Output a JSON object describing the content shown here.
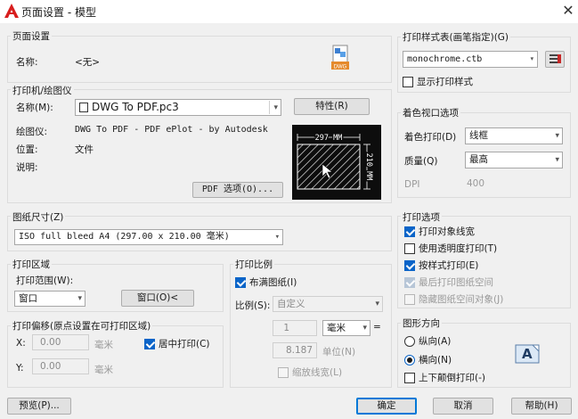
{
  "window": {
    "title": "页面设置 - 模型"
  },
  "page_setup": {
    "legend": "页面设置",
    "name_label": "名称:",
    "name_value": "<无>",
    "file_badge": "DWG"
  },
  "printer": {
    "legend": "打印机/绘图仪",
    "name_label": "名称(M):",
    "name_value": "DWG To PDF.pc3",
    "properties_button": "特性(R)",
    "plotter_label": "绘图仪:",
    "plotter_value": "DWG To PDF - PDF ePlot - by Autodesk",
    "location_label": "位置:",
    "location_value": "文件",
    "description_label": "说明:",
    "pdf_options_button": "PDF 选项(O)...",
    "preview_width_label": "297 MM",
    "preview_height_label": "210 MM"
  },
  "paper_size": {
    "legend": "图纸尺寸(Z)",
    "value": "ISO full bleed A4 (297.00 x 210.00 毫米)"
  },
  "plot_area": {
    "legend": "打印区域",
    "range_label": "打印范围(W):",
    "range_value": "窗口",
    "window_button": "窗口(O)<"
  },
  "plot_offset": {
    "legend": "打印偏移(原点设置在可打印区域)",
    "x_label": "X:",
    "x_value": "0.00",
    "x_unit": "毫米",
    "y_label": "Y:",
    "y_value": "0.00",
    "y_unit": "毫米",
    "center_label": "居中打印(C)",
    "center_checked": true
  },
  "plot_scale": {
    "legend": "打印比例",
    "fit_label": "布满图纸(I)",
    "fit_checked": true,
    "scale_label": "比例(S):",
    "scale_value": "自定义",
    "value1": "1",
    "unit1": "毫米",
    "equals": "=",
    "value2": "8.187",
    "unit2": "单位(N)",
    "lineweights_label": "缩放线宽(L)"
  },
  "plot_style": {
    "legend": "打印样式表(画笔指定)(G)",
    "value": "monochrome.ctb",
    "show_label": "显示打印样式"
  },
  "shaded_viewport": {
    "legend": "着色视口选项",
    "shade_label": "着色打印(D)",
    "shade_value": "线框",
    "quality_label": "质量(Q)",
    "quality_value": "最高",
    "dpi_label": "DPI",
    "dpi_value": "400"
  },
  "plot_options": {
    "legend": "打印选项",
    "items": [
      {
        "label": "打印对象线宽",
        "checked": true,
        "disabled": false
      },
      {
        "label": "使用透明度打印(T)",
        "checked": false,
        "disabled": false
      },
      {
        "label": "按样式打印(E)",
        "checked": true,
        "disabled": false
      },
      {
        "label": "最后打印图纸空间",
        "checked": true,
        "disabled": true
      },
      {
        "label": "隐藏图纸空间对象(J)",
        "checked": false,
        "disabled": true
      }
    ]
  },
  "orientation": {
    "legend": "图形方向",
    "portrait_label": "纵向(A)",
    "landscape_label": "横向(N)",
    "selected": "landscape",
    "upside_down_label": "上下颠倒打印(-)",
    "upside_down_checked": false,
    "preview_letter": "A"
  },
  "footer": {
    "preview_button": "预览(P)...",
    "ok_button": "确定",
    "cancel_button": "取消",
    "help_button": "帮助(H)"
  },
  "colors": {
    "accent": "#0a64c8",
    "app_red": "#d81e1e"
  }
}
